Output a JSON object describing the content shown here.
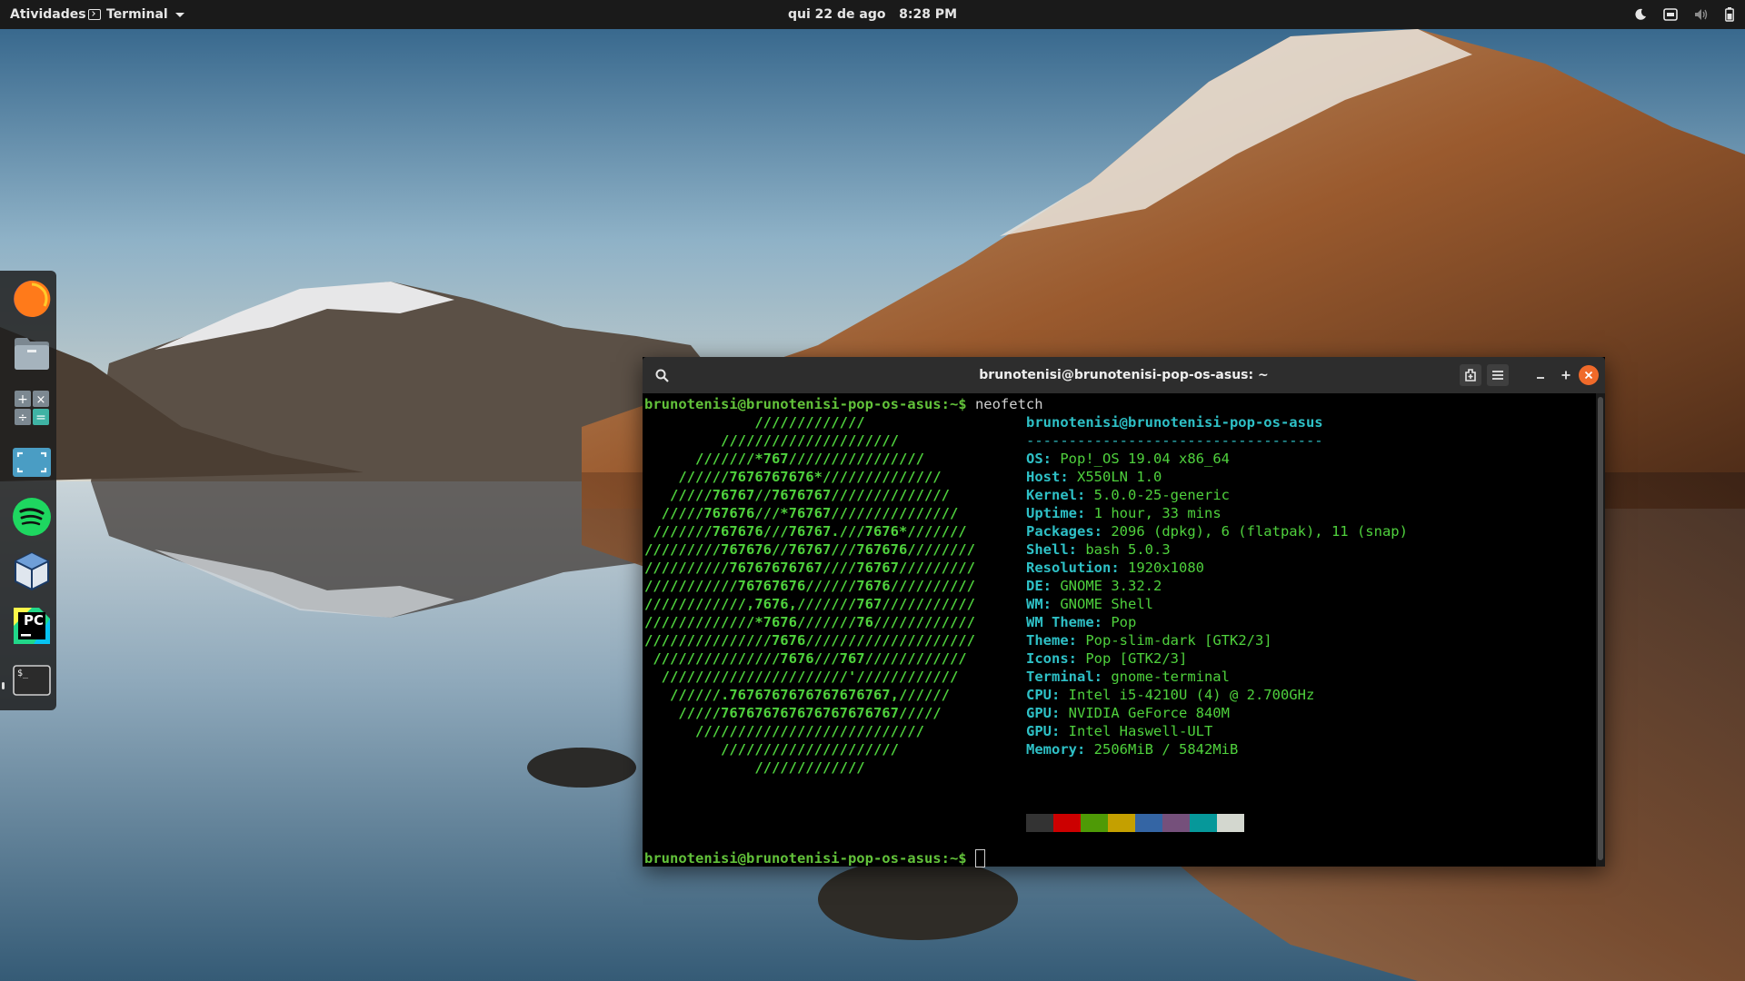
{
  "topbar": {
    "activities": "Atividades",
    "app_name": "Terminal",
    "date": "qui 22 de ago",
    "time": "8:28 PM",
    "icons": [
      "night-light-icon",
      "network-icon",
      "volume-icon",
      "battery-icon"
    ]
  },
  "dock": {
    "items": [
      {
        "name": "firefox",
        "icon": "firefox-icon"
      },
      {
        "name": "files",
        "icon": "files-icon"
      },
      {
        "name": "calculator",
        "icon": "calculator-icon"
      },
      {
        "name": "screenshot",
        "icon": "screenshot-icon"
      },
      {
        "name": "spotify",
        "icon": "spotify-icon"
      },
      {
        "name": "virtualbox",
        "icon": "virtualbox-icon"
      },
      {
        "name": "pycharm",
        "icon": "pycharm-icon",
        "label": "PC"
      },
      {
        "name": "terminal",
        "icon": "terminal-icon",
        "label": "$_",
        "running": true
      }
    ]
  },
  "window": {
    "title": "brunotenisi@brunotenisi-pop-os-asus: ~",
    "accent": "#f06a2a"
  },
  "terminal": {
    "prompt": "brunotenisi@brunotenisi-pop-os-asus:~$",
    "command": " neofetch",
    "logo": [
      "             /////////////",
      "         /////////////////////",
      "      ///////*767////////////////",
      "    //////7676767676*//////////////",
      "   /////76767//7676767//////////////",
      "  /////767676///*76767///////////////",
      " ///////767676///76767.///7676*///////",
      "/////////767676//76767///767676////////",
      "//////////76767676767////76767/////////",
      "///////////76767676//////7676//////////",
      "////////////,7676,///////767///////////",
      "/////////////*7676///////76////////////",
      "///////////////7676////////////////////",
      " ///////////////7676///767////////////",
      "  //////////////////////'////////////",
      "   //////.7676767676767676767,//////",
      "    /////767676767676767676767/////",
      "      ///////////////////////////",
      "         /////////////////////",
      "             /////////////"
    ],
    "info_title": "brunotenisi@brunotenisi-pop-os-asus",
    "separator": "-----------------------------------",
    "info": [
      {
        "key": "OS",
        "value": "Pop!_OS 19.04 x86_64"
      },
      {
        "key": "Host",
        "value": "X550LN 1.0"
      },
      {
        "key": "Kernel",
        "value": "5.0.0-25-generic"
      },
      {
        "key": "Uptime",
        "value": "1 hour, 33 mins"
      },
      {
        "key": "Packages",
        "value": "2096 (dpkg), 6 (flatpak), 11 (snap)"
      },
      {
        "key": "Shell",
        "value": "bash 5.0.3"
      },
      {
        "key": "Resolution",
        "value": "1920x1080"
      },
      {
        "key": "DE",
        "value": "GNOME 3.32.2"
      },
      {
        "key": "WM",
        "value": "GNOME Shell"
      },
      {
        "key": "WM Theme",
        "value": "Pop"
      },
      {
        "key": "Theme",
        "value": "Pop-slim-dark [GTK2/3]"
      },
      {
        "key": "Icons",
        "value": "Pop [GTK2/3]"
      },
      {
        "key": "Terminal",
        "value": "gnome-terminal"
      },
      {
        "key": "CPU",
        "value": "Intel i5-4210U (4) @ 2.700GHz"
      },
      {
        "key": "GPU",
        "value": "NVIDIA GeForce 840M"
      },
      {
        "key": "GPU",
        "value": "Intel Haswell-ULT"
      },
      {
        "key": "Memory",
        "value": "2506MiB / 5842MiB"
      }
    ],
    "palette": [
      "#333333",
      "#cc0000",
      "#4e9a06",
      "#c4a000",
      "#3465a4",
      "#75507b",
      "#06989a",
      "#d3d7cf"
    ]
  }
}
